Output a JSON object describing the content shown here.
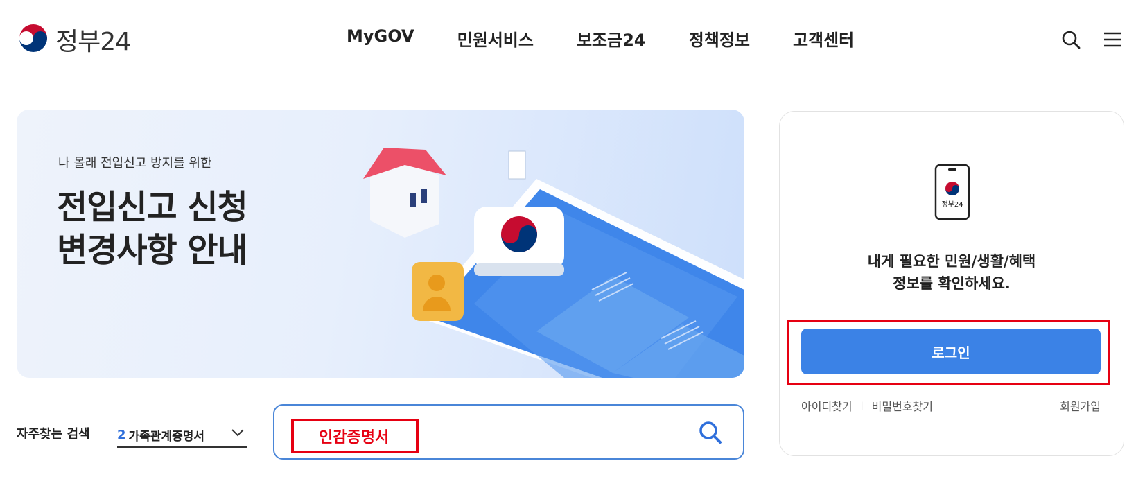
{
  "header": {
    "logo_text": "정부24",
    "nav": [
      "MyGOV",
      "민원서비스",
      "보조금24",
      "정책정보",
      "고객센터"
    ],
    "icons": [
      "search-icon",
      "menu-icon"
    ]
  },
  "banner": {
    "subtitle": "나 몰래 전입신고 방지를 위한",
    "title_line1": "전입신고 신청",
    "title_line2": "변경사항 안내"
  },
  "login": {
    "phone_icon_text": "정부24",
    "message_line1": "내게 필요한 민원/생활/혜택",
    "message_line2": "정보를 확인하세요.",
    "button_label": "로그인",
    "find_id": "아이디찾기",
    "find_password": "비밀번호찾기",
    "signup": "회원가입"
  },
  "search": {
    "favorite_label": "자주찾는 검색",
    "favorite_rank": "2",
    "favorite_item": "가족관계증명서",
    "input_value": "인감증명서"
  },
  "colors": {
    "accent_blue": "#3b82e6",
    "highlight_red": "#e60012",
    "logo_red": "#c60c30",
    "logo_blue": "#003478"
  }
}
